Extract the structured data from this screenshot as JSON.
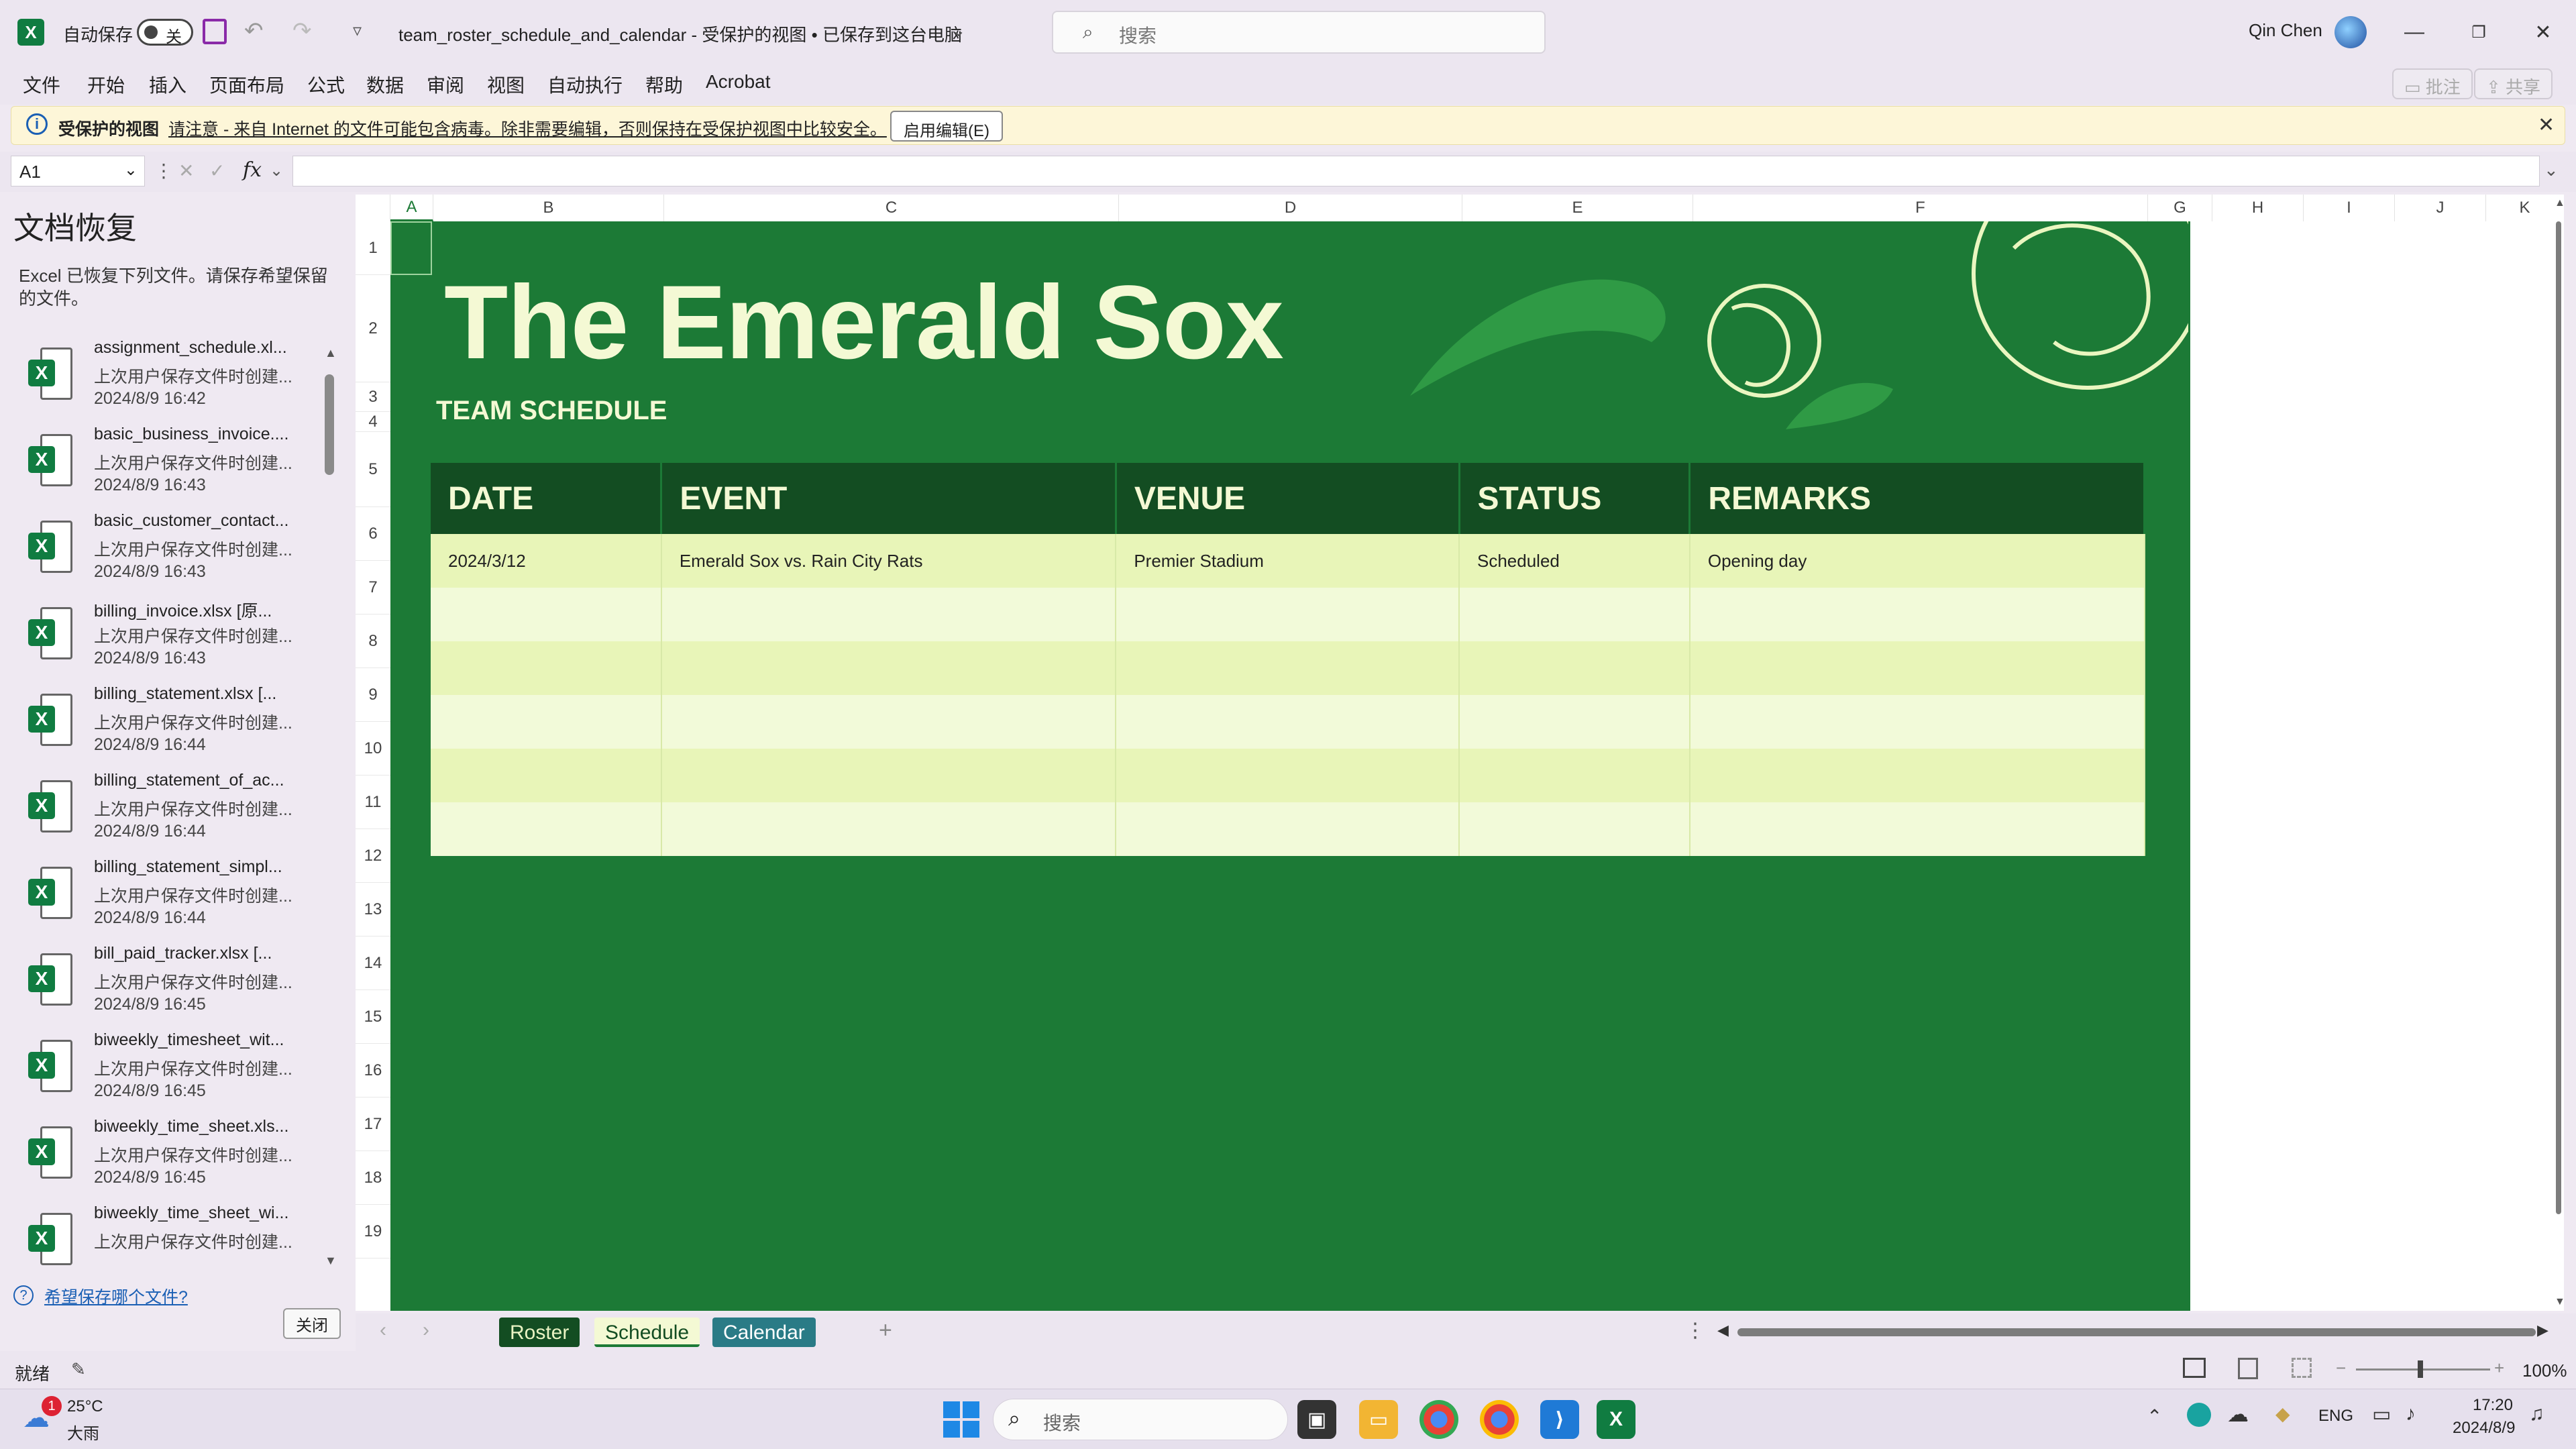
{
  "titlebar": {
    "autosave_label": "自动保存",
    "autosave_state": "关",
    "doc_title": "team_roster_schedule_and_calendar  -  受保护的视图 • 已保存到这台电脑",
    "search_placeholder": "搜索",
    "user_name": "Qin Chen"
  },
  "menu": {
    "items": [
      "文件",
      "开始",
      "插入",
      "页面布局",
      "公式",
      "数据",
      "审阅",
      "视图",
      "自动执行",
      "帮助",
      "Acrobat"
    ],
    "comment_label": "批注",
    "share_label": "共享"
  },
  "protected_view": {
    "label": "受保护的视图",
    "message": "请注意 - 来自 Internet 的文件可能包含病毒。除非需要编辑，否则保持在受保护视图中比较安全。",
    "enable_button": "启用编辑(E)"
  },
  "formula_bar": {
    "name_box": "A1",
    "fx": "fx",
    "value": ""
  },
  "recovery": {
    "title": "文档恢复",
    "description": "Excel 已恢复下列文件。请保存希望保留的文件。",
    "files": [
      {
        "name": "assignment_schedule.xl...",
        "sub": "上次用户保存文件时创建...",
        "date": "2024/8/9 16:42"
      },
      {
        "name": "basic_business_invoice....",
        "sub": "上次用户保存文件时创建...",
        "date": "2024/8/9 16:43"
      },
      {
        "name": "basic_customer_contact...",
        "sub": "上次用户保存文件时创建...",
        "date": "2024/8/9 16:43"
      },
      {
        "name": "billing_invoice.xlsx  [原...",
        "sub": "上次用户保存文件时创建...",
        "date": "2024/8/9 16:43"
      },
      {
        "name": "billing_statement.xlsx  [...",
        "sub": "上次用户保存文件时创建...",
        "date": "2024/8/9 16:44"
      },
      {
        "name": "billing_statement_of_ac...",
        "sub": "上次用户保存文件时创建...",
        "date": "2024/8/9 16:44"
      },
      {
        "name": "billing_statement_simpl...",
        "sub": "上次用户保存文件时创建...",
        "date": "2024/8/9 16:44"
      },
      {
        "name": "bill_paid_tracker.xlsx  [...",
        "sub": "上次用户保存文件时创建...",
        "date": "2024/8/9 16:45"
      },
      {
        "name": "biweekly_timesheet_wit...",
        "sub": "上次用户保存文件时创建...",
        "date": "2024/8/9 16:45"
      },
      {
        "name": "biweekly_time_sheet.xls...",
        "sub": "上次用户保存文件时创建...",
        "date": "2024/8/9 16:45"
      },
      {
        "name": "biweekly_time_sheet_wi...",
        "sub": "上次用户保存文件时创建...",
        "date": ""
      }
    ],
    "which_link": "希望保存哪个文件?",
    "close_button": "关闭"
  },
  "grid": {
    "columns": [
      "A",
      "B",
      "C",
      "D",
      "E",
      "F",
      "G",
      "H",
      "I",
      "J",
      "K"
    ],
    "rows": [
      "1",
      "2",
      "3",
      "4",
      "5",
      "6",
      "7",
      "8",
      "9",
      "10",
      "11",
      "12",
      "13",
      "14",
      "15",
      "16",
      "17",
      "18",
      "19"
    ]
  },
  "sheet": {
    "title": "The Emerald Sox",
    "subtitle": "TEAM SCHEDULE",
    "headers": [
      "DATE",
      "EVENT",
      "VENUE",
      "STATUS",
      "REMARKS"
    ],
    "rows": [
      [
        "2024/3/12",
        "Emerald Sox vs. Rain City Rats",
        "Premier Stadium",
        "Scheduled",
        "Opening day"
      ],
      [
        "",
        "",
        "",
        "",
        ""
      ],
      [
        "",
        "",
        "",
        "",
        ""
      ],
      [
        "",
        "",
        "",
        "",
        ""
      ],
      [
        "",
        "",
        "",
        "",
        ""
      ],
      [
        "",
        "",
        "",
        "",
        ""
      ]
    ],
    "colors": {
      "background": "#1c7a36",
      "header": "#134d22",
      "row_alt_1": "#e8f5b8",
      "row_alt_2": "#f2fad9",
      "title": "#f4f9d4"
    }
  },
  "tabs": [
    "Roster",
    "Schedule",
    "Calendar"
  ],
  "statusbar": {
    "ready": "就绪",
    "zoom": "100%"
  },
  "taskbar": {
    "weather_temp": "25°C",
    "weather_desc": "大雨",
    "weather_badge": "1",
    "search_placeholder": "搜索",
    "lang": "ENG",
    "time": "17:20",
    "date": "2024/8/9"
  }
}
